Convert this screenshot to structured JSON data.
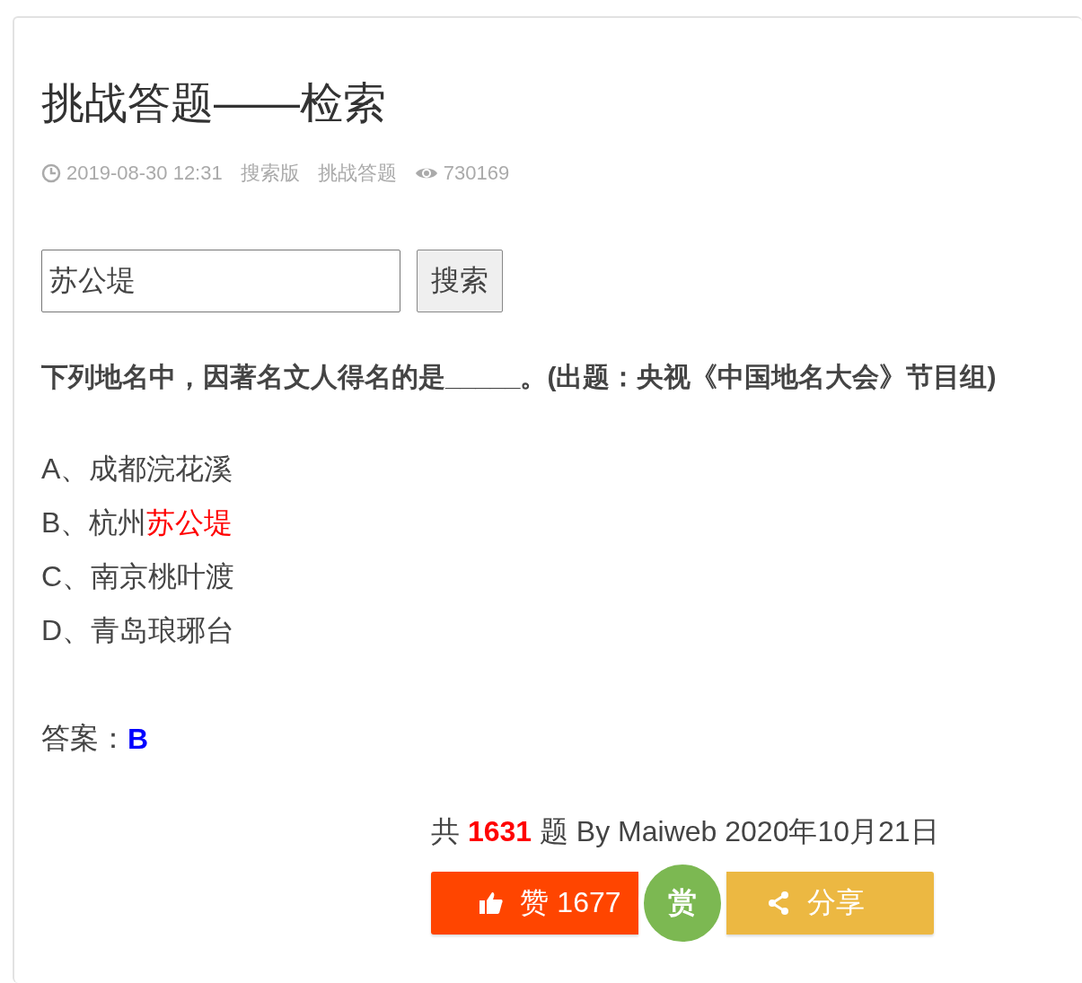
{
  "title": "挑战答题——检索",
  "meta": {
    "datetime": "2019-08-30 12:31",
    "tags": [
      "搜索版",
      "挑战答题"
    ],
    "views": "730169"
  },
  "search": {
    "value": "苏公堤",
    "button": "搜索"
  },
  "question": "下列地名中，因著名文人得名的是_____。(出题：央视《中国地名大会》节目组)",
  "options": [
    {
      "text": "A、成都浣花溪"
    },
    {
      "text": "B、杭州",
      "highlight": "苏公堤"
    },
    {
      "text": "C、南京桃叶渡"
    },
    {
      "text": "D、青岛琅琊台"
    }
  ],
  "answer": {
    "label": "答案：",
    "value": "B"
  },
  "footer": "共 **1631** 题 By Maiweb 2020年10月21日",
  "actions": {
    "like": "赞 1677",
    "reward": "赏",
    "share": "分享"
  }
}
